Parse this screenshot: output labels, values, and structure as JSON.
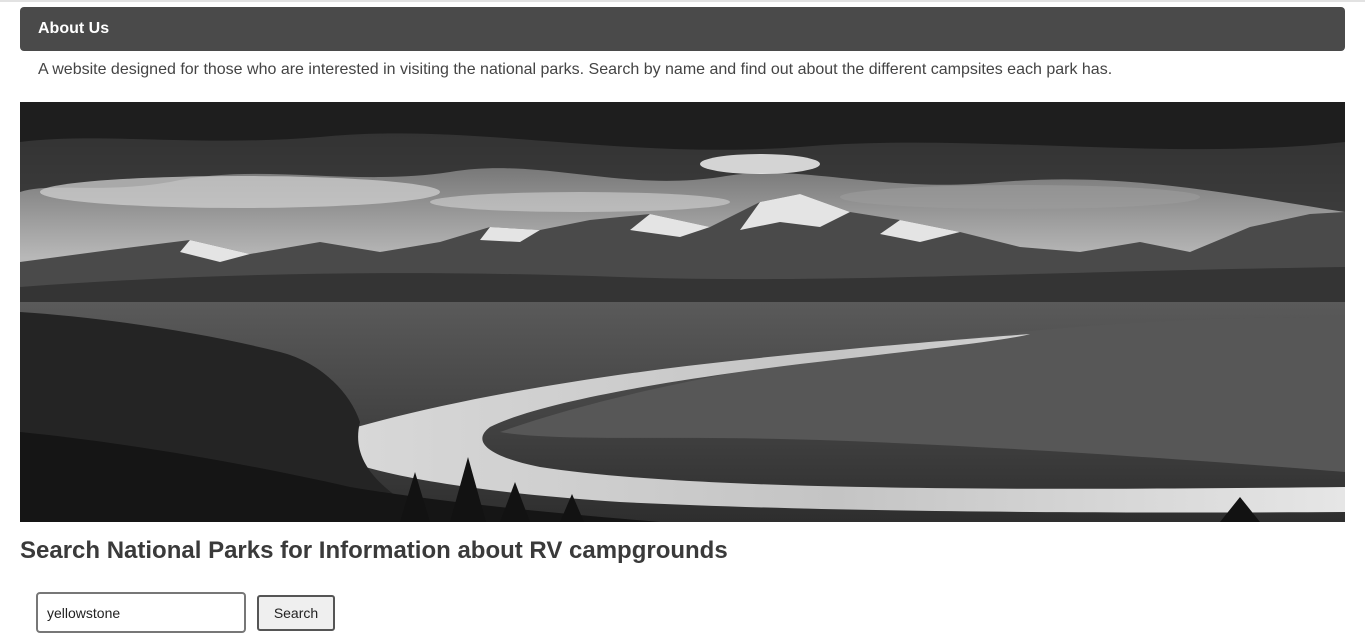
{
  "about": {
    "title": "About Us",
    "description": "A website designed for those who are interested in visiting the national parks. Search by name and find out about the different campsites each park has."
  },
  "hero": {
    "image": "black-and-white landscape photo of snow-capped mountains with a winding river and forest"
  },
  "search": {
    "heading": "Search National Parks for Information about RV campgrounds",
    "input_value": "yellowstone",
    "button_label": "Search"
  },
  "colors": {
    "header_bg": "#4a4a4a",
    "header_text": "#ffffff",
    "body_text": "#3a3a3a"
  }
}
